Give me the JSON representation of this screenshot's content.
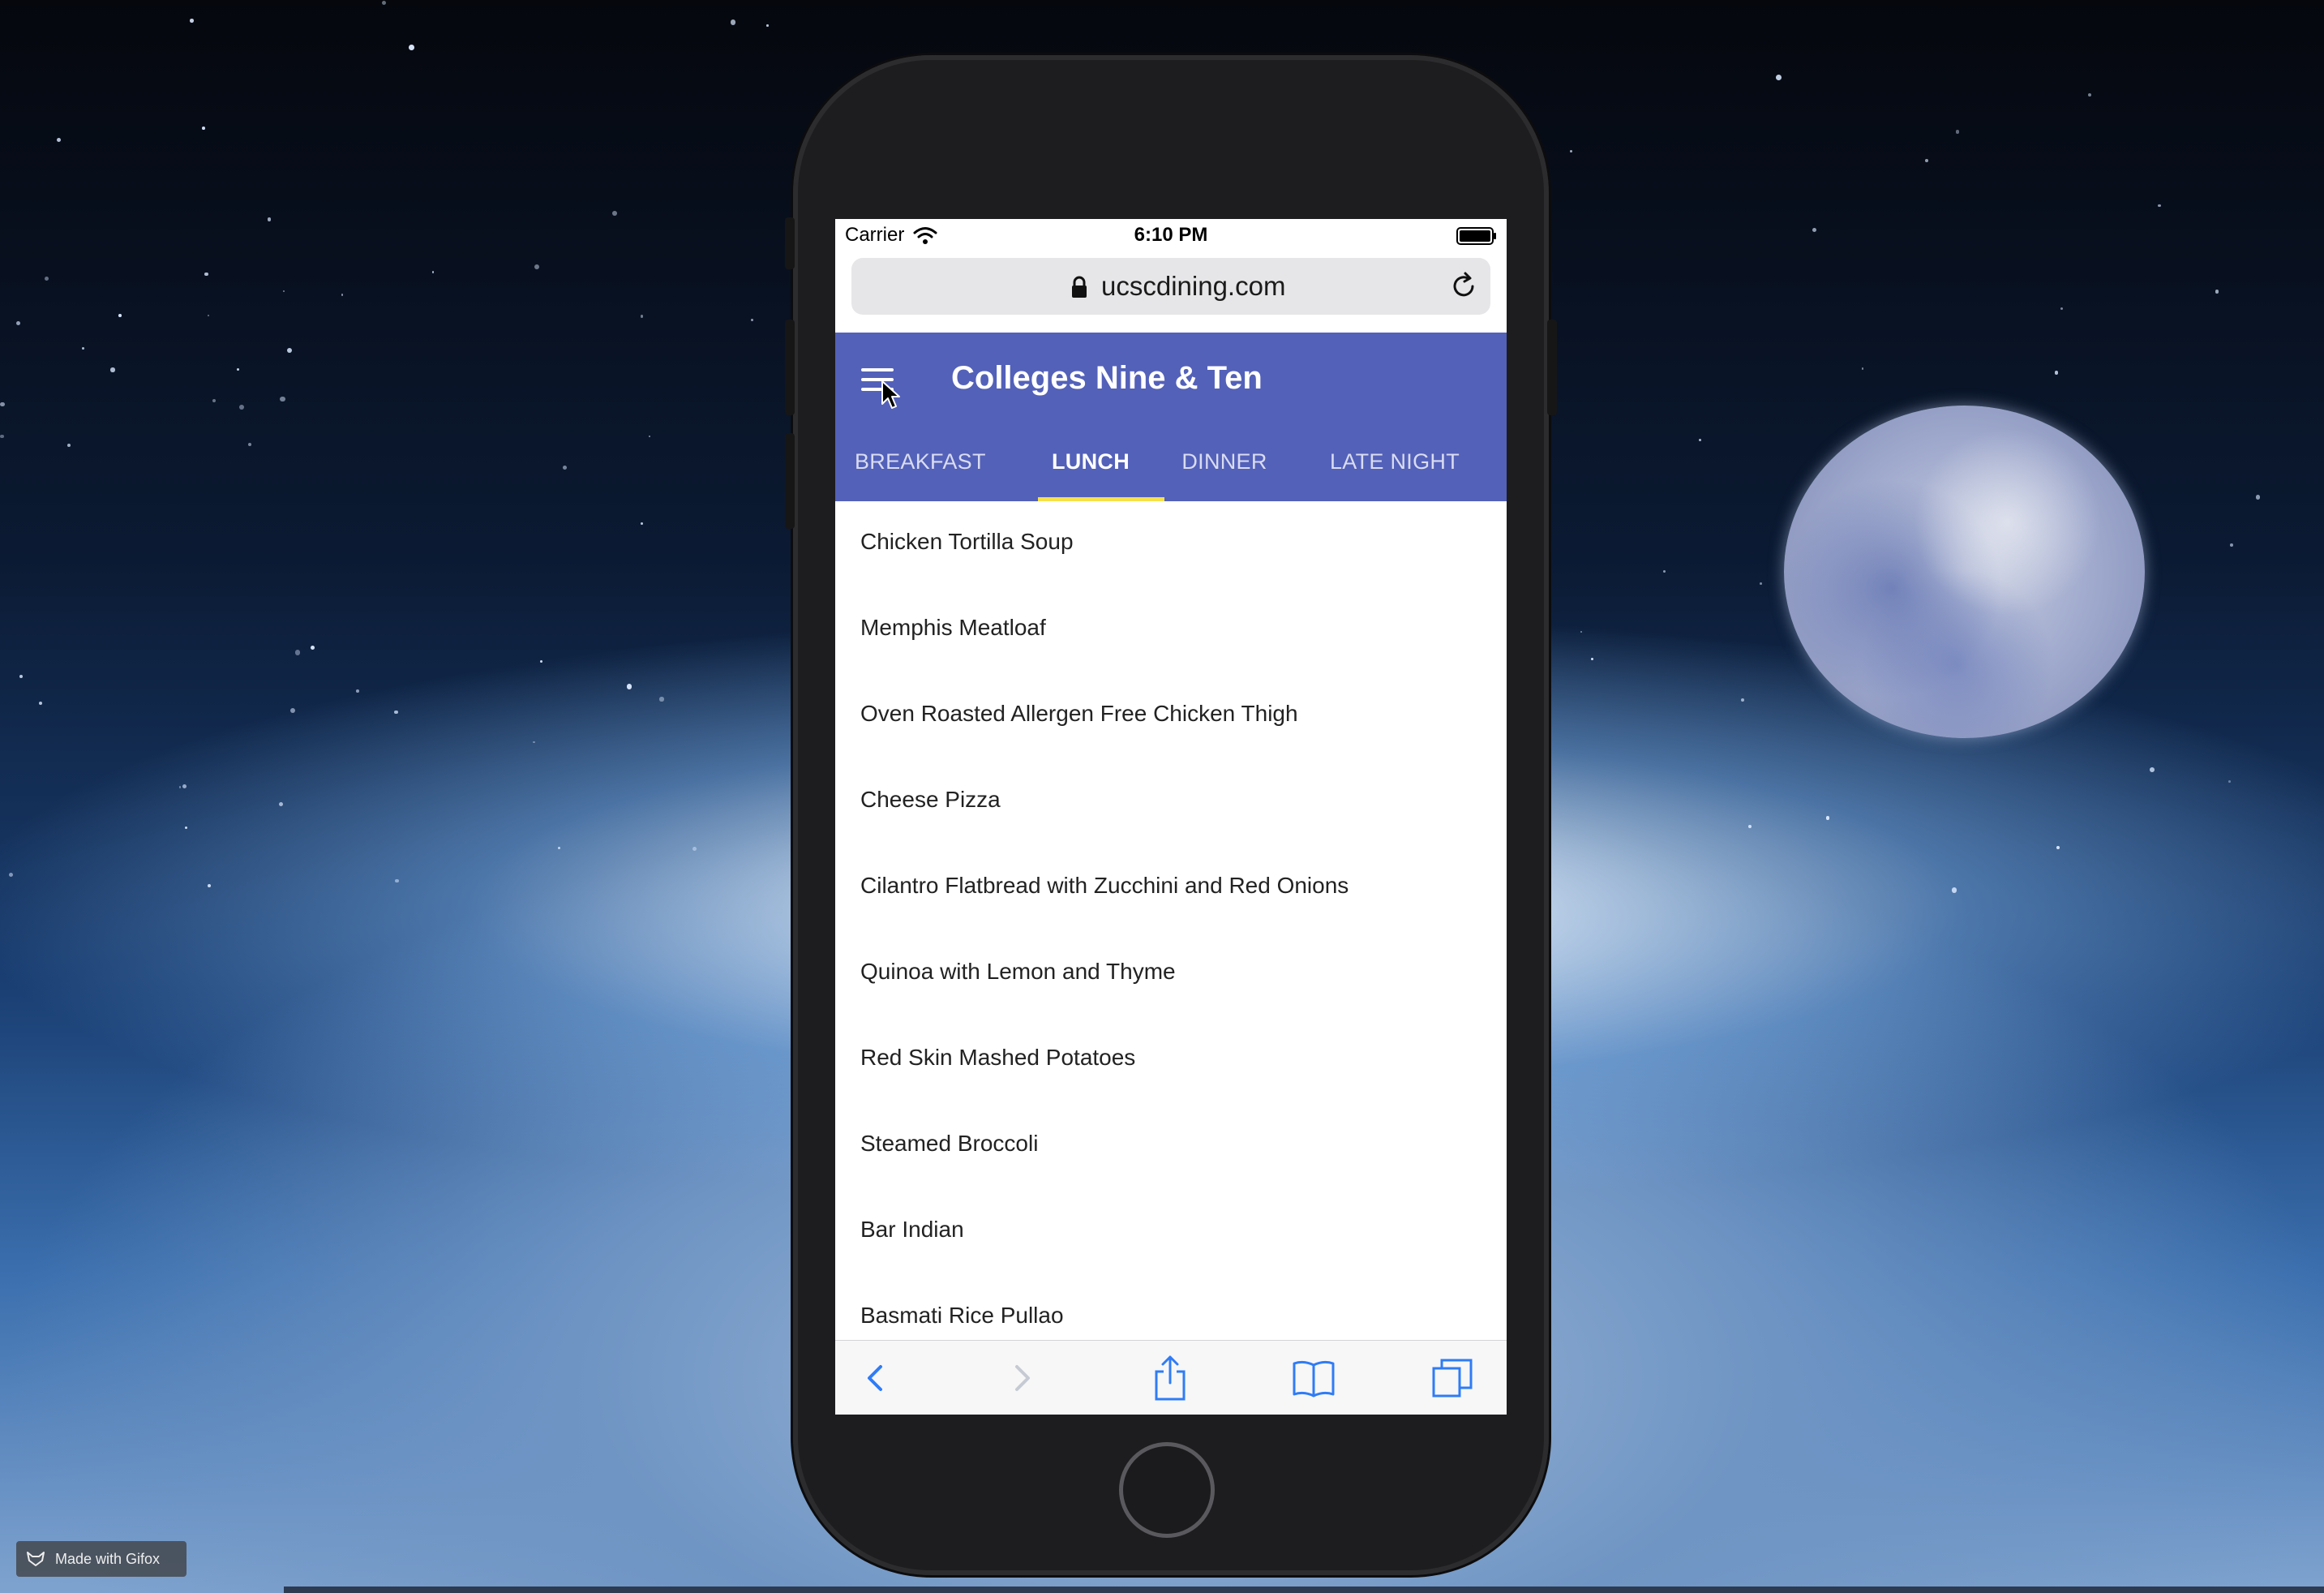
{
  "status_bar": {
    "carrier": "Carrier",
    "time": "6:10 PM"
  },
  "browser": {
    "url": "ucscdining.com"
  },
  "app": {
    "title": "Colleges Nine & Ten",
    "accent_color": "#5361b9",
    "indicator_color": "#f5e04d",
    "tabs": [
      {
        "label": "BREAKFAST",
        "active": false
      },
      {
        "label": "LUNCH",
        "active": true
      },
      {
        "label": "DINNER",
        "active": false
      },
      {
        "label": "LATE NIGHT",
        "active": false
      }
    ],
    "menu_items": [
      "Chicken Tortilla Soup",
      "Memphis Meatloaf",
      "Oven Roasted Allergen Free Chicken Thigh",
      "Cheese Pizza",
      "Cilantro Flatbread with Zucchini and Red Onions",
      "Quinoa with Lemon and Thyme",
      "Red Skin Mashed Potatoes",
      "Steamed Broccoli",
      "Bar Indian",
      "Basmati Rice Pullao"
    ]
  },
  "toolbar": {
    "icons": [
      "back-icon",
      "forward-icon",
      "share-icon",
      "bookmarks-icon",
      "tabs-icon"
    ]
  },
  "watermark": {
    "text": "Made with Gifox"
  }
}
